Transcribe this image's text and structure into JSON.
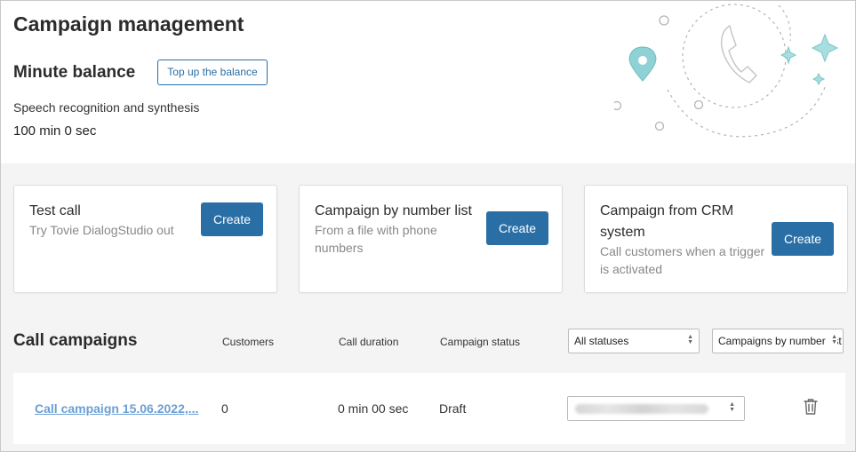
{
  "header": {
    "title": "Campaign management"
  },
  "balance": {
    "title": "Minute balance",
    "topup_label": "Top up the balance",
    "speech_label": "Speech recognition and synthesis",
    "speech_value": "100 min 0 sec"
  },
  "cards": [
    {
      "title": "Test call",
      "subtitle": "Try Tovie DialogStudio out",
      "button": "Create"
    },
    {
      "title": "Campaign by number list",
      "subtitle_line1": "From a file with phone",
      "subtitle_line2": "numbers",
      "button": "Create"
    },
    {
      "title_line1": "Campaign from CRM",
      "title_line2": "system",
      "subtitle_line1": "Call customers when a trigger",
      "subtitle_line2": "is activated",
      "button": "Create"
    }
  ],
  "campaigns": {
    "title": "Call campaigns",
    "columns": {
      "customers": "Customers",
      "duration": "Call duration",
      "status": "Campaign status"
    },
    "filters": {
      "status_value": "All statuses",
      "type_value": "Campaigns by number list"
    },
    "rows": [
      {
        "name": "Call campaign 15.06.2022,...",
        "customers": "0",
        "duration": "0 min 00 sec",
        "status": "Draft"
      }
    ]
  },
  "icons": {
    "illustration": "phone-location-illustration",
    "select_arrows": "up-down-chevron-icon",
    "delete": "trash-icon"
  },
  "colors": {
    "accent": "#2a6ea6",
    "link": "#6a9fd4",
    "illustration": "#8fd1d4"
  }
}
